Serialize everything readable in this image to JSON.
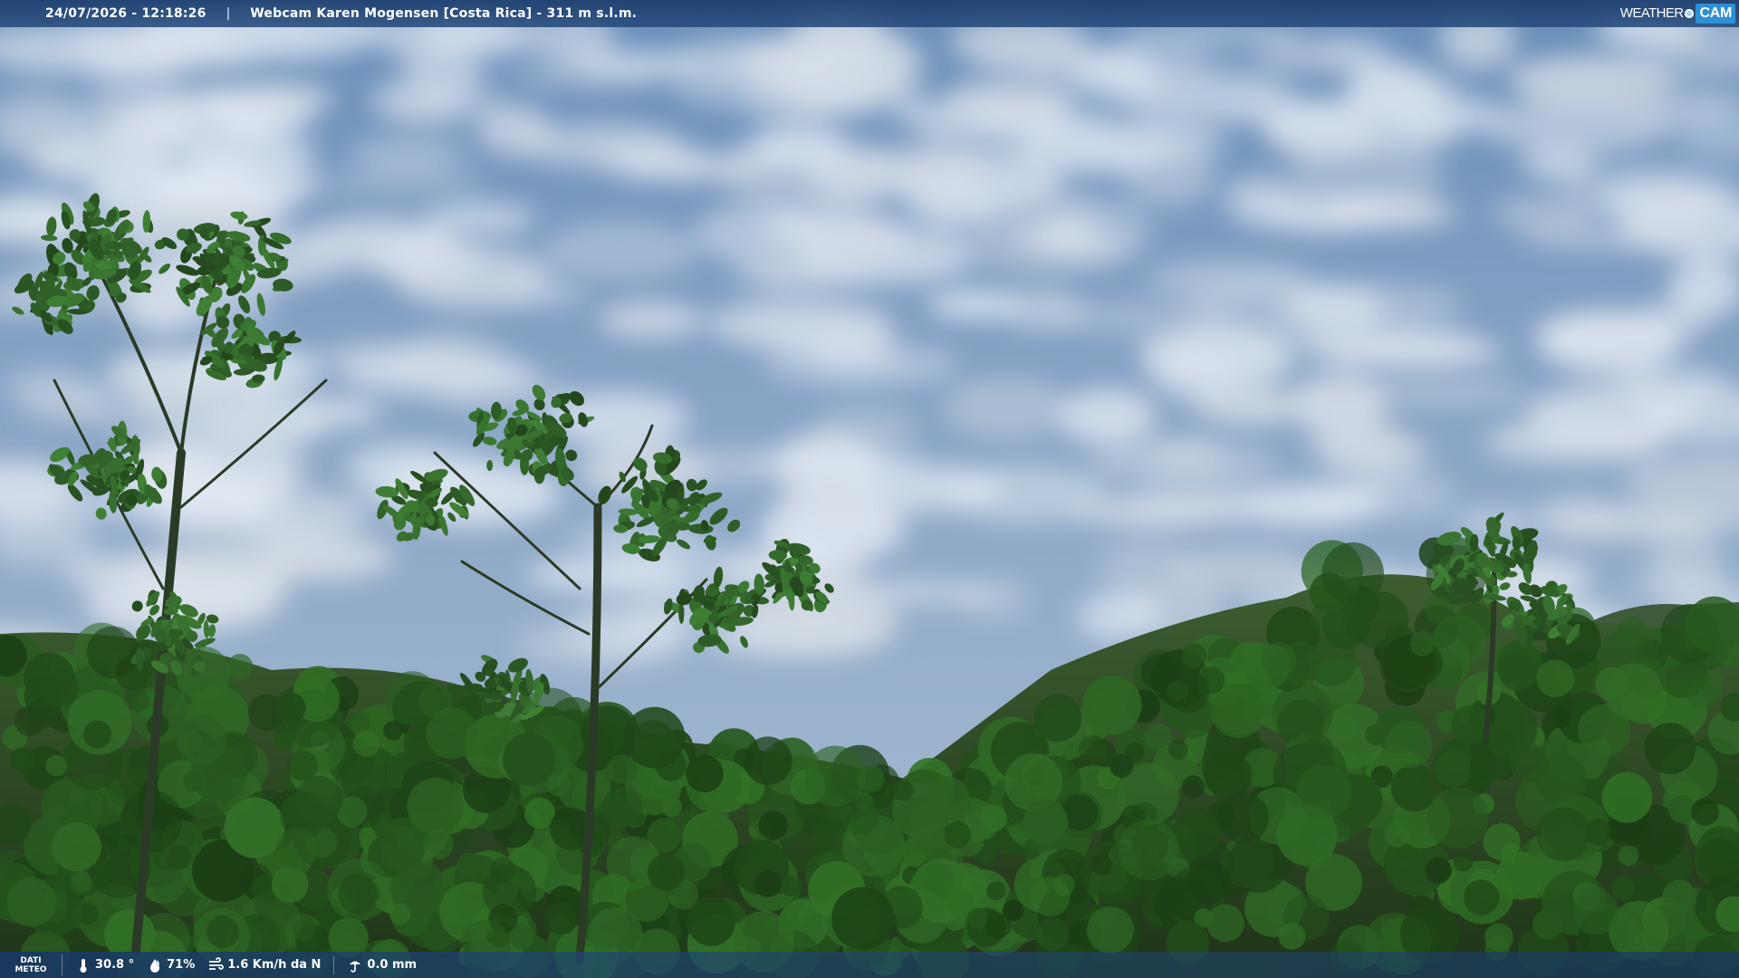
{
  "header": {
    "timestamp": "24/07/2026 - 12:18:26",
    "separator": "|",
    "title": "Webcam Karen Mogensen [Costa Rica] - 311 m s.l.m.",
    "logo_weather": "WEATHER",
    "logo_cam": "CAM"
  },
  "footer": {
    "label_line1": "DATI",
    "label_line2": "METEO",
    "temperature": "30.8 °",
    "humidity": "71%",
    "wind": "1.6 Km/h da N",
    "rain": "0.0 mm"
  },
  "icons": {
    "temperature": "thermometer-icon",
    "humidity": "humidity-drop-icon",
    "wind": "wind-icon",
    "rain": "rain-gauge-icon"
  },
  "colors": {
    "bar": "#1c3e6e",
    "logo_accent": "#2f8fd8",
    "sky_top": "#6f93bd",
    "sky_bottom": "#9fb8d0",
    "foliage": "#2e4a24"
  }
}
